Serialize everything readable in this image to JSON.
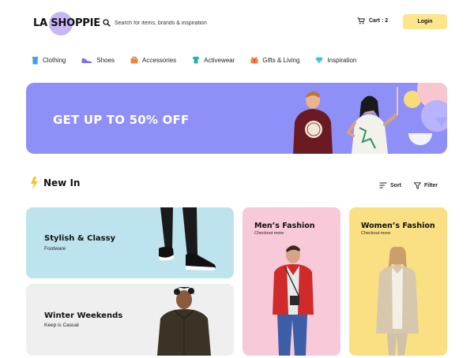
{
  "header": {
    "logo": "LA SHOPPIE",
    "search_placeholder": "Search for items, brands & inspiration",
    "cart_label": "Cart : 2",
    "login_label": "Login"
  },
  "categories": [
    {
      "label": "Clothing",
      "icon": "shirt-icon"
    },
    {
      "label": "Shoes",
      "icon": "shoe-icon"
    },
    {
      "label": "Accessories",
      "icon": "bag-icon"
    },
    {
      "label": "Activewear",
      "icon": "tshirt-icon"
    },
    {
      "label": "Gifts & Living",
      "icon": "gift-icon"
    },
    {
      "label": "Inspiration",
      "icon": "diamond-icon"
    }
  ],
  "banner": {
    "title": "GET UP TO 50% OFF",
    "color": "#8f8ff8"
  },
  "section": {
    "title": "New In",
    "sort_label": "Sort",
    "filter_label": "Filter"
  },
  "cards": [
    {
      "title": "Stylish & Classy",
      "subtitle": "Footware",
      "color": "#bde4ee"
    },
    {
      "title": "Winter Weekends",
      "subtitle": "Keep is Casual",
      "color": "#efefef"
    },
    {
      "title": "Men’s Fashion",
      "subtitle": "Checkout more",
      "color": "#f7c9d9"
    },
    {
      "title": "Women’s Fashion",
      "subtitle": "Checkout more",
      "color": "#fae083"
    }
  ],
  "colors": {
    "accent_yellow": "#fde58c",
    "logo_blob": "#c9b6f5",
    "lightning": "#f5c518"
  }
}
